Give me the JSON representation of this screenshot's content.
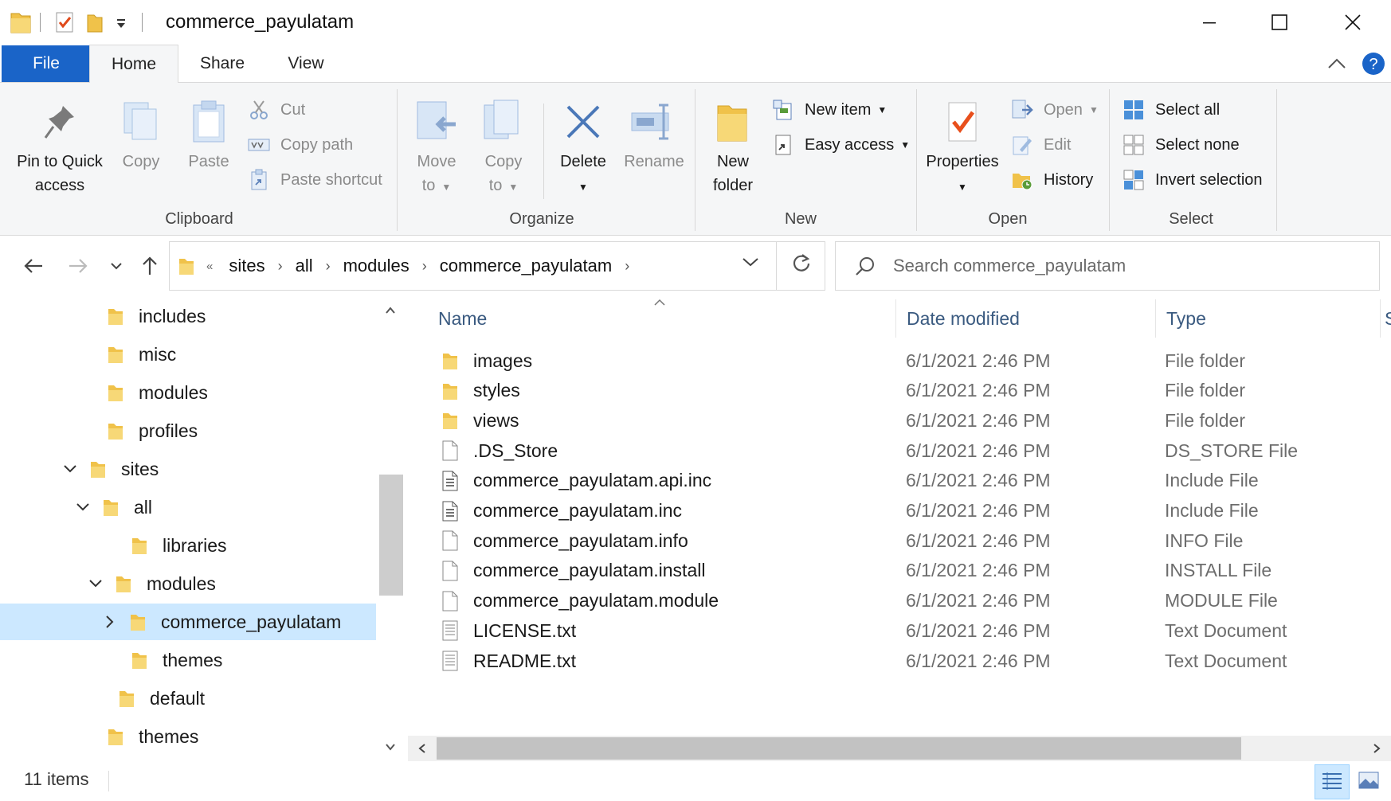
{
  "window": {
    "title": "commerce_payulatam",
    "controls": [
      "minimize",
      "maximize",
      "close"
    ]
  },
  "quick_access": [
    "folder-icon",
    "properties-checkmark-icon",
    "new-folder-icon",
    "customize-dropdown-icon"
  ],
  "ribbon": {
    "tabs": [
      {
        "label": "File"
      },
      {
        "label": "Home"
      },
      {
        "label": "Share"
      },
      {
        "label": "View"
      }
    ],
    "groups": {
      "clipboard": {
        "label": "Clipboard",
        "pin_line1": "Pin to Quick",
        "pin_line2": "access",
        "copy": "Copy",
        "paste": "Paste",
        "cut": "Cut",
        "copy_path": "Copy path",
        "paste_shortcut": "Paste shortcut"
      },
      "organize": {
        "label": "Organize",
        "move_line1": "Move",
        "move_line2": "to",
        "copy_line1": "Copy",
        "copy_line2": "to",
        "delete": "Delete",
        "rename": "Rename"
      },
      "new": {
        "label": "New",
        "new_folder_line1": "New",
        "new_folder_line2": "folder",
        "new_item": "New item",
        "easy_access": "Easy access"
      },
      "open": {
        "label": "Open",
        "properties": "Properties",
        "open": "Open",
        "edit": "Edit",
        "history": "History"
      },
      "select": {
        "label": "Select",
        "select_all": "Select all",
        "select_none": "Select none",
        "invert_selection": "Invert selection"
      }
    }
  },
  "address": {
    "overflow": "«",
    "crumbs": [
      "sites",
      "all",
      "modules",
      "commerce_payulatam"
    ]
  },
  "search": {
    "placeholder": "Search commerce_payulatam"
  },
  "tree": [
    {
      "label": "includes"
    },
    {
      "label": "misc"
    },
    {
      "label": "modules"
    },
    {
      "label": "profiles"
    },
    {
      "label": "sites"
    },
    {
      "label": "all"
    },
    {
      "label": "libraries"
    },
    {
      "label": "modules"
    },
    {
      "label": "commerce_payulatam"
    },
    {
      "label": "themes"
    },
    {
      "label": "default"
    },
    {
      "label": "themes"
    }
  ],
  "columns": {
    "name": "Name",
    "date": "Date modified",
    "type": "Type",
    "size": "S"
  },
  "files": [
    {
      "name": "images",
      "date": "6/1/2021 2:46 PM",
      "type": "File folder",
      "icon": "folder-icon"
    },
    {
      "name": "styles",
      "date": "6/1/2021 2:46 PM",
      "type": "File folder",
      "icon": "folder-icon"
    },
    {
      "name": "views",
      "date": "6/1/2021 2:46 PM",
      "type": "File folder",
      "icon": "folder-icon"
    },
    {
      "name": ".DS_Store",
      "date": "6/1/2021 2:46 PM",
      "type": "DS_STORE File",
      "icon": "blank-file-icon"
    },
    {
      "name": "commerce_payulatam.api.inc",
      "date": "6/1/2021 2:46 PM",
      "type": "Include File",
      "icon": "code-file-icon"
    },
    {
      "name": "commerce_payulatam.inc",
      "date": "6/1/2021 2:46 PM",
      "type": "Include File",
      "icon": "code-file-icon"
    },
    {
      "name": "commerce_payulatam.info",
      "date": "6/1/2021 2:46 PM",
      "type": "INFO File",
      "icon": "blank-file-icon"
    },
    {
      "name": "commerce_payulatam.install",
      "date": "6/1/2021 2:46 PM",
      "type": "INSTALL File",
      "icon": "blank-file-icon"
    },
    {
      "name": "commerce_payulatam.module",
      "date": "6/1/2021 2:46 PM",
      "type": "MODULE File",
      "icon": "blank-file-icon"
    },
    {
      "name": "LICENSE.txt",
      "date": "6/1/2021 2:46 PM",
      "type": "Text Document",
      "icon": "text-file-icon"
    },
    {
      "name": "README.txt",
      "date": "6/1/2021 2:46 PM",
      "type": "Text Document",
      "icon": "text-file-icon"
    }
  ],
  "status": {
    "item_count": "11 items"
  },
  "colors": {
    "accent": "#1a64c8",
    "selection": "#cce8ff",
    "folder": "#f0c24a",
    "column_header": "#3a5a80"
  }
}
